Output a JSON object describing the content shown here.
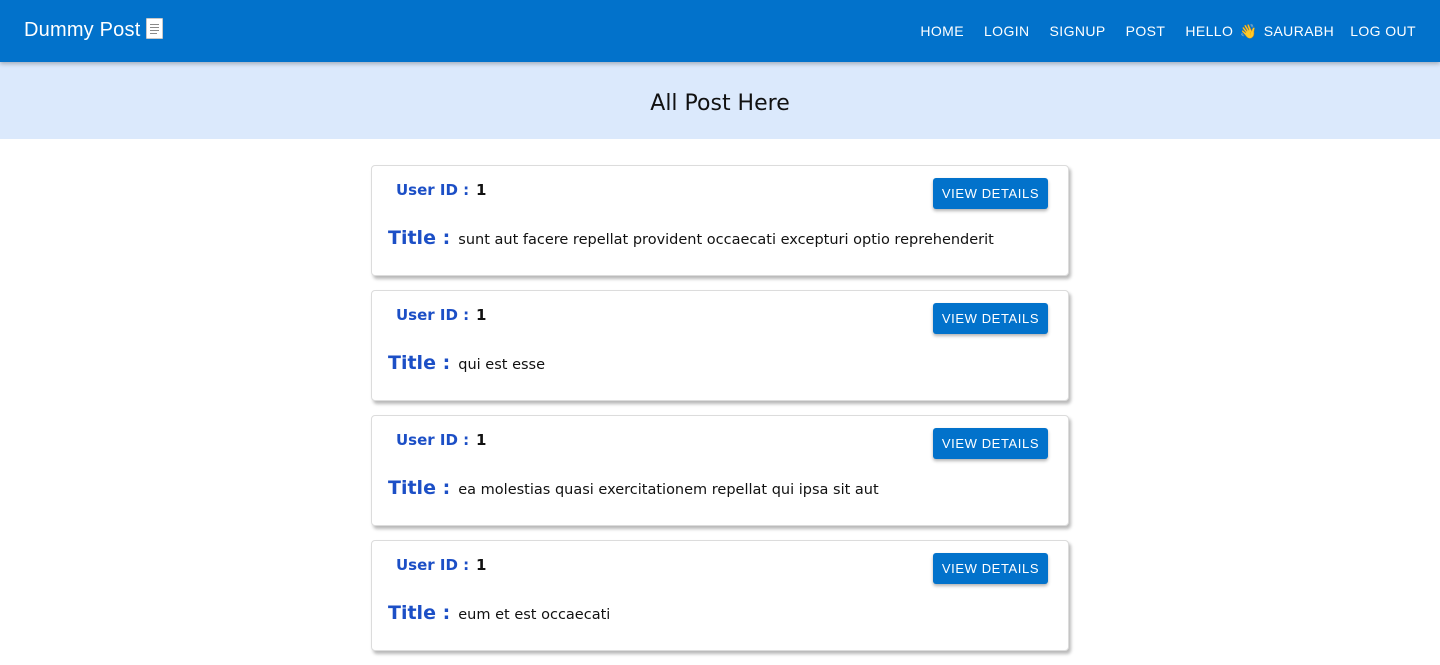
{
  "header": {
    "brand": "Dummy Post",
    "brand_icon": "document-icon",
    "nav": {
      "home": "HOME",
      "login": "LOGIN",
      "signup": "SIGNUP",
      "post": "POST",
      "hello_prefix": "HELLO",
      "hello_icon": "waving-hand-icon",
      "user_name": "SAURABH",
      "logout": "LOG OUT"
    },
    "color": "#0272cb"
  },
  "page_title": "All Post Here",
  "posts": [
    {
      "user_label": "User ID :",
      "user_id": "1",
      "button_label": "VIEW DETAILS",
      "title_label": "Title :",
      "title": "sunt aut facere repellat provident occaecati excepturi optio reprehenderit"
    },
    {
      "user_label": "User ID :",
      "user_id": "1",
      "button_label": "VIEW DETAILS",
      "title_label": "Title :",
      "title": "qui est esse"
    },
    {
      "user_label": "User ID :",
      "user_id": "1",
      "button_label": "VIEW DETAILS",
      "title_label": "Title :",
      "title": "ea molestias quasi exercitationem repellat qui ipsa sit aut"
    },
    {
      "user_label": "User ID :",
      "user_id": "1",
      "button_label": "VIEW DETAILS",
      "title_label": "Title :",
      "title": "eum et est occaecati"
    }
  ]
}
